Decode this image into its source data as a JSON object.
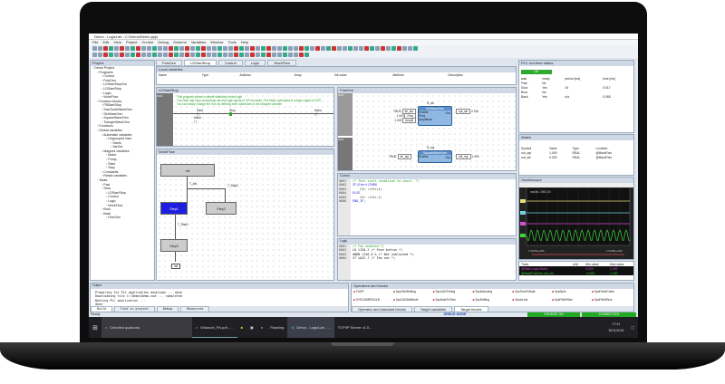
{
  "window": {
    "title": "Demo - LogicLab - C:\\Demo\\Demo.ppjs"
  },
  "menu": [
    "File",
    "Edit",
    "View",
    "Project",
    "On-line",
    "Debug",
    "Scheme",
    "Variables",
    "Window",
    "Tools",
    "Help"
  ],
  "doc_tabs": [
    "FctsGen",
    "LDStartStop",
    "Control",
    "Logic",
    "WorkFlow"
  ],
  "local_vars": {
    "title": "Local variables",
    "headers": [
      "Name",
      "Type",
      "Address",
      "Array",
      "Init value",
      "Attribute",
      "Description"
    ]
  },
  "project": {
    "title": "Project",
    "items": [
      "Demo Project",
      "Programs",
      "Control",
      "FctsGen",
      "LDStartStopOut",
      "LDStartStop",
      "Logic",
      "WorkFlow",
      "Function blocks",
      "FBStartStop",
      "SawToothWaveGen",
      "SinWaveGen",
      "SquareWaveGen",
      "TriangleWaveGen",
      "Functions",
      "Global variables",
      "Automatic variables",
      "Ungrouped Vars",
      "Starts",
      "VarOut",
      "Mapped variables",
      "Motor",
      "Pump",
      "Start",
      "Stop",
      "Constants",
      "Retain variables",
      "Tasks",
      "Fast",
      "Slow",
      "LDStartStop",
      "Control",
      "Logic",
      "WorkFlow",
      "Boot",
      "Back",
      "FctsGen"
    ]
  },
  "ld": {
    "title": "LDStartStop",
    "comments": [
      "This program shows a simple start/stop motor logic",
      "The Start and Stop commands are two logic inputs of CPU module. The Motor command is a logic output of CPU",
      "You can easily change the I/Os by defining their addresses in the Mapped variable"
    ],
    "start": "Start",
    "stop": "Stop",
    "motor": "Motor",
    "motor_hold": "Motor",
    "row": "0001"
  },
  "fbd": {
    "title": "FctsGen",
    "rows": [
      "0001",
      "0002"
    ],
    "sin": {
      "name": "N_sin",
      "type": "SinWaveGen",
      "inputs": [
        "Enable",
        "Freq",
        "Amplitude"
      ],
      "in_vals": [
        "TRUE",
        "1.000",
        "1.000"
      ],
      "in_vars": [
        "en_sin",
        "Freq",
        "Amplit"
      ],
      "output": "Out",
      "out_var": "out_sin",
      "out_val": "0.010"
    },
    "sqr": {
      "name": "N_sqr",
      "type": "SquareWaveGen",
      "inputs": [
        "Enable"
      ],
      "in_vals": [
        "TRUE"
      ],
      "in_vars": [
        "en_sqr"
      ],
      "output": "Out",
      "out_var": "out_sqr",
      "out_val": "1.000"
    }
  },
  "sfc": {
    "title": "WorkFlow",
    "init": "Init",
    "t0": "T_Init",
    "step1": "Step1",
    "step2": "Step2",
    "t1": "T_Step1",
    "t2": "T_Step2",
    "step3": "Step3",
    "jump": "Init"
  },
  "control": {
    "title": "Control",
    "lines": [
      [
        "0001",
        "(* Test start condition to count. *)"
      ],
      [
        "0002",
        "IF(Start)THEN"
      ],
      [
        "0003",
        "    Ctr :=Ctr+1;"
      ],
      [
        "0004",
        "ELSE"
      ],
      [
        "0005",
        "    Ctr :=Ctr-1;"
      ],
      [
        "0006",
        "END_IF;"
      ]
    ]
  },
  "logic": {
    "title": "Logic",
    "lines": [
      [
        "0001",
        "(* Fan enabled *)"
      ],
      [
        "0002",
        "LD %IX0.2 (* Push button *)"
      ],
      [
        "0003",
        "ANDN %IX0.0 & (* Not unblocked *)"
      ],
      [
        "0004",
        "ST %QX2.7 (* Fan out *)"
      ]
    ]
  },
  "plc_status": {
    "title": "PLC run-time status",
    "state": "OK",
    "headers": [
      "task",
      "ready",
      "period [ms]",
      "time [ms]"
    ],
    "rows": [
      [
        "Fast",
        "No",
        "",
        ""
      ],
      [
        "Slow",
        "Yes",
        "10",
        "0.017"
      ],
      [
        "Boot",
        "No",
        "",
        ""
      ],
      [
        "Back",
        "Yes",
        "n/a",
        "0.068"
      ]
    ]
  },
  "watch": {
    "title": "Watch",
    "headers": [
      "Symbol",
      "Value",
      "Type",
      "Location"
    ],
    "rows": [
      [
        "out_sqr",
        "1.000",
        "REAL",
        "@BackFcts"
      ],
      [
        "out_sin",
        "0.025",
        "REAL",
        "@BackFcts"
      ]
    ]
  },
  "scope": {
    "title": "Oscilloscope",
    "msdiv": "ms/div: 2000.00",
    "t_start": "1.5276e+006",
    "t_end": "1.5435e+006",
    "colors": [
      "#e6e07a",
      "#6fd4e6",
      "#d24fd2",
      "#3bd63b"
    ]
  },
  "track": {
    "headers": [
      "Track",
      "Unit",
      "Min value",
      "Max value"
    ],
    "rows": [
      [
        "@Start.Logic.Motor",
        "",
        "0.000",
        "1.000"
      ],
      [
        "@BackFctsGen.out_sin",
        "",
        "-1.000",
        "1.000"
      ]
    ]
  },
  "output": {
    "title": "Output",
    "lines": [
      "Preparing for PLC application download ... done",
      "Downloading file C:\\Demo\\Demo.cod ... completed",
      "Booting PLC application ...",
      "done"
    ],
    "tabs": [
      "Build",
      "Find in project",
      "Debug",
      "Resources"
    ]
  },
  "operators": {
    "title": "Operators and blocks",
    "items": [
      "FILEP",
      "SysCANRxMsg",
      "SysCANTxMsg",
      "SysDaListing",
      "SysTimeToDate",
      "SysSpiIo",
      "SysFileWChars",
      "SYSCANRESULB",
      "SysCANSetMode",
      "SysDateToTime",
      "SysDirMng",
      "SysIoLine",
      "SysFileWSize",
      "SysFileWSize"
    ],
    "tabs": [
      "Operator and standard blocks",
      "Target variables",
      "Target blocks"
    ]
  },
  "statusbar": {
    "ready": "Ready",
    "debug": "DEBUG MODE",
    "source": "SOURCE OK",
    "connected": "CONNECTED"
  },
  "taskbar": {
    "search": "Chiedimi qualcosa",
    "apps": [
      "\\\\Manuel_FN.pdf - ...",
      "Flashing",
      "Demo - LogicLab - ...",
      "TCP/IP Server v1.0..."
    ],
    "time": "17:24",
    "date": "30/11/2016"
  }
}
